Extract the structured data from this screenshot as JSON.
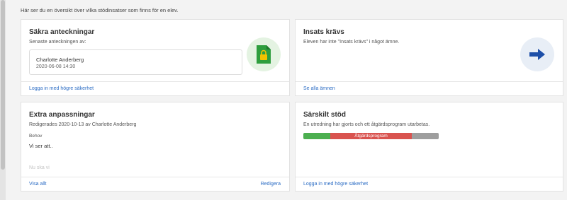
{
  "intro": "Här ser du en översikt över vilka stödinsatser som finns för en elev.",
  "secure_notes": {
    "title": "Säkra anteckningar",
    "subtitle": "Senaste anteckningen av:",
    "author": "Charlotte Anderberg",
    "timestamp": "2020-06-08 14:30",
    "footer_link": "Logga in med högre säkerhet",
    "icon_color": "#2e9e3e"
  },
  "action_required": {
    "title": "Insats krävs",
    "description": "Eleven har inte \"Insats krävs\" i något ämne.",
    "footer_link": "Se alla ämnen",
    "icon_color": "#1d4fa8"
  },
  "extra_adjustments": {
    "title": "Extra anpassningar",
    "subtitle": "Redigerades 2020-10-13 av Charlotte Anderberg",
    "need_label": "Behov",
    "need_text": "Vi ser att..",
    "placeholder_text": "Nu ska vi",
    "view_all_link": "Visa allt",
    "edit_link": "Redigera"
  },
  "special_support": {
    "title": "Särskilt stöd",
    "description": "En utredning har gjorts och ett åtgärdsprogram utarbetas.",
    "progress_label": "Åtgärdsprogram",
    "footer_link": "Logga in med högre säkerhet",
    "colors": {
      "done": "#4caf50",
      "current": "#d9534f",
      "remaining": "#9e9e9e"
    }
  }
}
